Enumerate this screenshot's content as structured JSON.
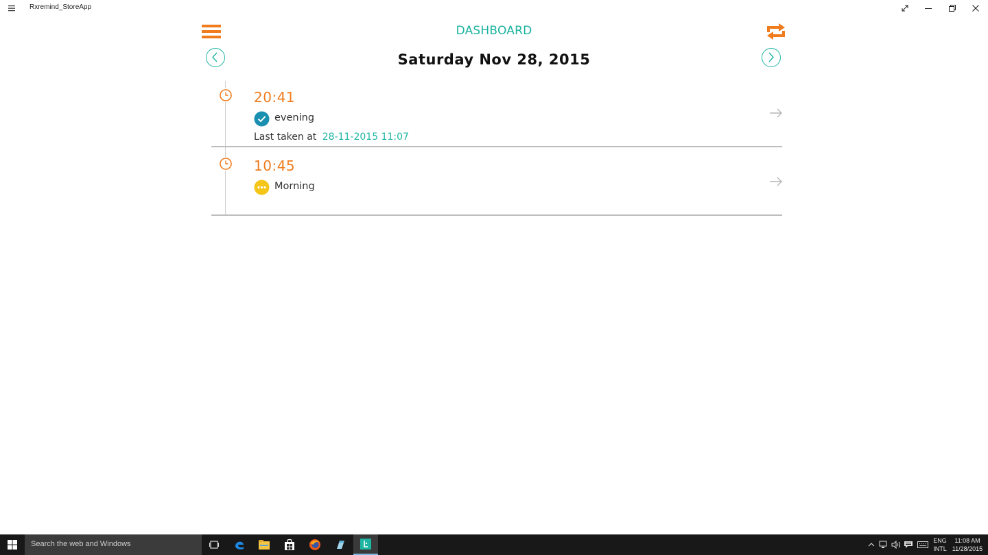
{
  "window": {
    "title": "Rxremind_StoreApp",
    "menu_icon": "hamburger-menu-icon",
    "buttons": [
      "expand-icon",
      "minimize-icon",
      "restore-icon",
      "close-icon"
    ]
  },
  "header": {
    "title": "DASHBOARD",
    "menu_icon": "hamburger-menu-icon",
    "sync_icon": "sync-repeat-icon",
    "date": "Saturday Nov 28, 2015",
    "prev_icon": "chevron-left-icon",
    "next_icon": "chevron-right-icon"
  },
  "reminders": [
    {
      "time": "20:41",
      "label": "evening",
      "status": "taken",
      "status_icon": "check-circle-icon",
      "last_taken_label": "Last taken at",
      "last_taken_value": "28-11-2015 11:07"
    },
    {
      "time": "10:45",
      "label": "Morning",
      "status": "pending",
      "status_icon": "pending-dots-icon"
    }
  ],
  "colors": {
    "accent_orange": "#f07c1e",
    "accent_teal": "#1fb5a3",
    "taken_blue": "#1a8fb0",
    "pending_yellow": "#f5c518"
  },
  "taskbar": {
    "search_placeholder": "Search the web and Windows",
    "apps": [
      "task-view-icon",
      "edge-icon",
      "file-explorer-icon",
      "store-icon",
      "firefox-icon",
      "app-icon",
      "rxremind-app-icon"
    ],
    "language": {
      "line1": "ENG",
      "line2": "INTL"
    },
    "time": "11:08 AM",
    "date": "11/28/2015"
  }
}
